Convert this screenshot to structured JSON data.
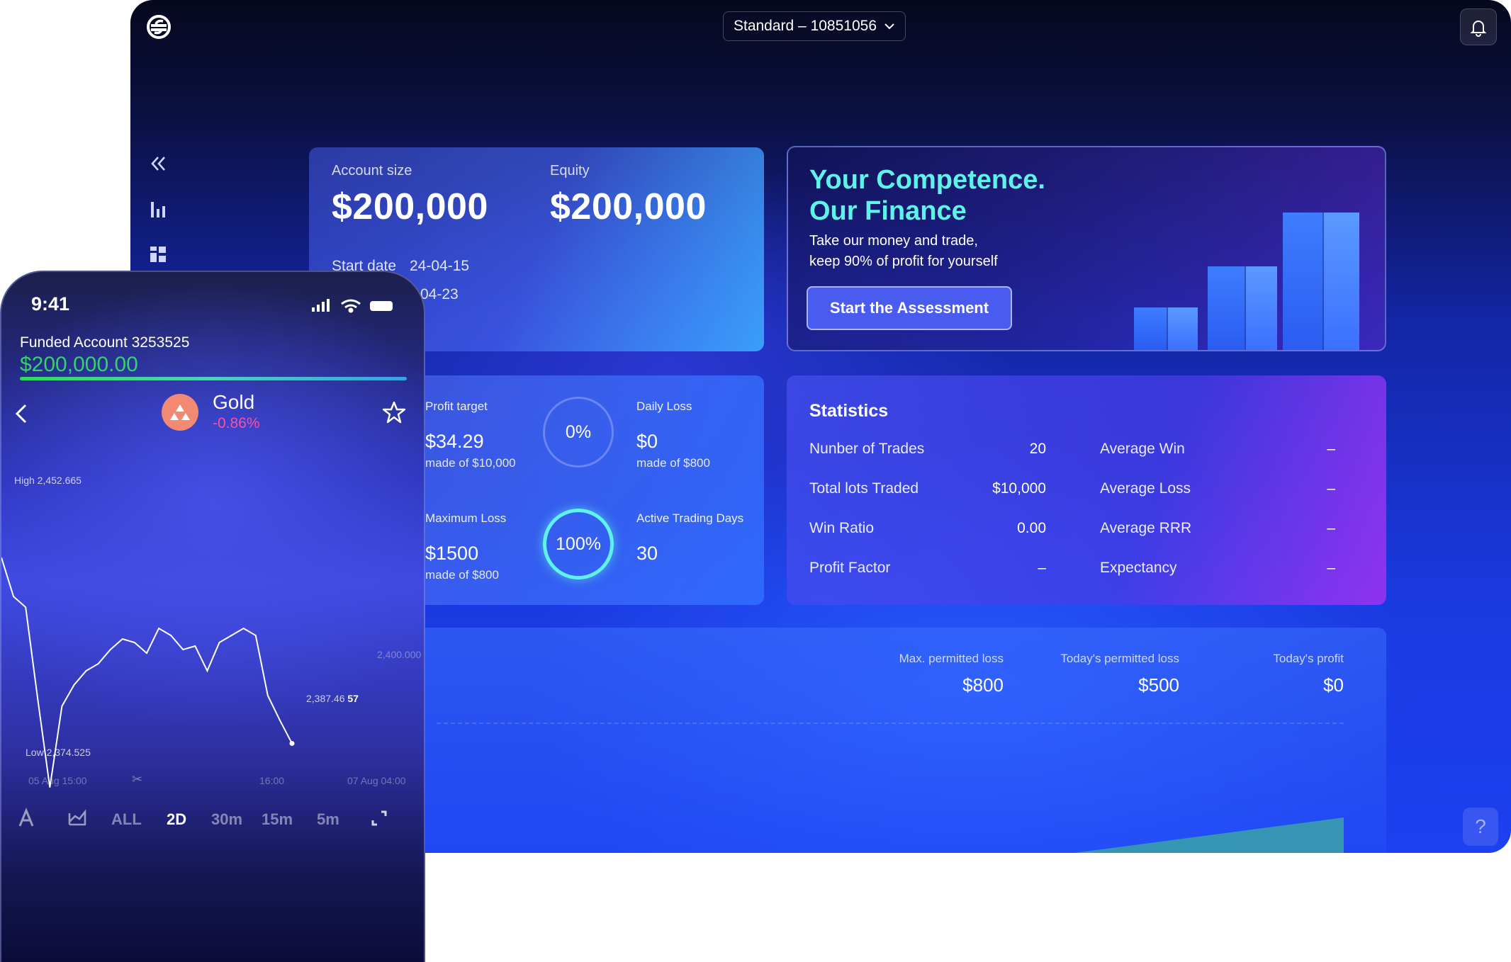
{
  "desktop": {
    "account_select": {
      "label": "Standard – 10851056"
    },
    "account_card": {
      "account_size_label": "Account size",
      "account_size_value": "$200,000",
      "equity_label": "Equity",
      "equity_value": "$200,000",
      "start_date_label": "Start date",
      "start_date_value": "24-04-15",
      "end_date_partial": "-04-23"
    },
    "promo": {
      "title_line1": "Your Competence.",
      "title_line2": "Our Finance",
      "subtitle_line1": "Take our money and trade,",
      "subtitle_line2": "keep 90% of profit for yourself",
      "button_label": "Start the Assessment"
    },
    "metrics": {
      "profit_target_label": "Profit target",
      "profit_target_value": "$34.29",
      "profit_target_sub": "made of $10,000",
      "profit_ring": "0%",
      "daily_loss_label": "Daily Loss",
      "daily_loss_value": "$0",
      "daily_loss_sub": "made of $800",
      "max_loss_label": "Maximum Loss",
      "max_loss_value": "$1500",
      "max_loss_sub": "made of $800",
      "max_loss_ring": "100%",
      "active_days_label": "Active Trading Days",
      "active_days_value": "30"
    },
    "statistics": {
      "title": "Statistics",
      "left": [
        {
          "label": "Nunber of Trades",
          "value": "20"
        },
        {
          "label": "Total lots Traded",
          "value": "$10,000"
        },
        {
          "label": "Win Ratio",
          "value": "0.00"
        },
        {
          "label": "Profit Factor",
          "value": "–"
        }
      ],
      "right": [
        {
          "label": "Average Win",
          "value": "–"
        },
        {
          "label": "Average Loss",
          "value": "–"
        },
        {
          "label": "Average RRR",
          "value": "–"
        },
        {
          "label": "Expectancy",
          "value": "–"
        }
      ]
    },
    "loss_panel": {
      "max_permitted_label": "Max. permitted loss",
      "max_permitted_value": "$800",
      "today_permitted_label": "Today's permitted loss",
      "today_permitted_value": "$500",
      "today_profit_label": "Today's profit",
      "today_profit_value": "$0"
    },
    "help_label": "?"
  },
  "phone": {
    "time": "9:41",
    "account_label": "Funded Account 3253525",
    "balance": "$200,000.00",
    "instrument": "Gold",
    "change": "-0.86%",
    "high_label": "High 2,452.665",
    "low_label": "Low 2,374.525",
    "price_label_main": "2,387.46",
    "price_label_bold": "57",
    "axis_right_mid": "2,400.000",
    "x_labels": [
      "05 Aug 15:00",
      "16:00",
      "07 Aug 04:00"
    ],
    "timeframes": [
      "ALL",
      "2D",
      "30m",
      "15m",
      "5m"
    ],
    "active_timeframe": "2D"
  },
  "chart_data": {
    "type": "line",
    "series": [
      {
        "values": [
          2440,
          2429,
          2426,
          2400,
          2375,
          2398,
          2404,
          2408,
          2410,
          2414,
          2417,
          2416,
          2413,
          2420,
          2418,
          2414,
          2415,
          2408,
          2416,
          2418,
          2420,
          2418,
          2401,
          2394,
          2387.46
        ]
      }
    ],
    "ylim": [
      2374.525,
      2452.665
    ]
  },
  "colors": {
    "accent_teal": "#5ef2e8",
    "positive": "#34d36a",
    "negative": "#ff4fa3",
    "button": "#4a5cf0"
  }
}
